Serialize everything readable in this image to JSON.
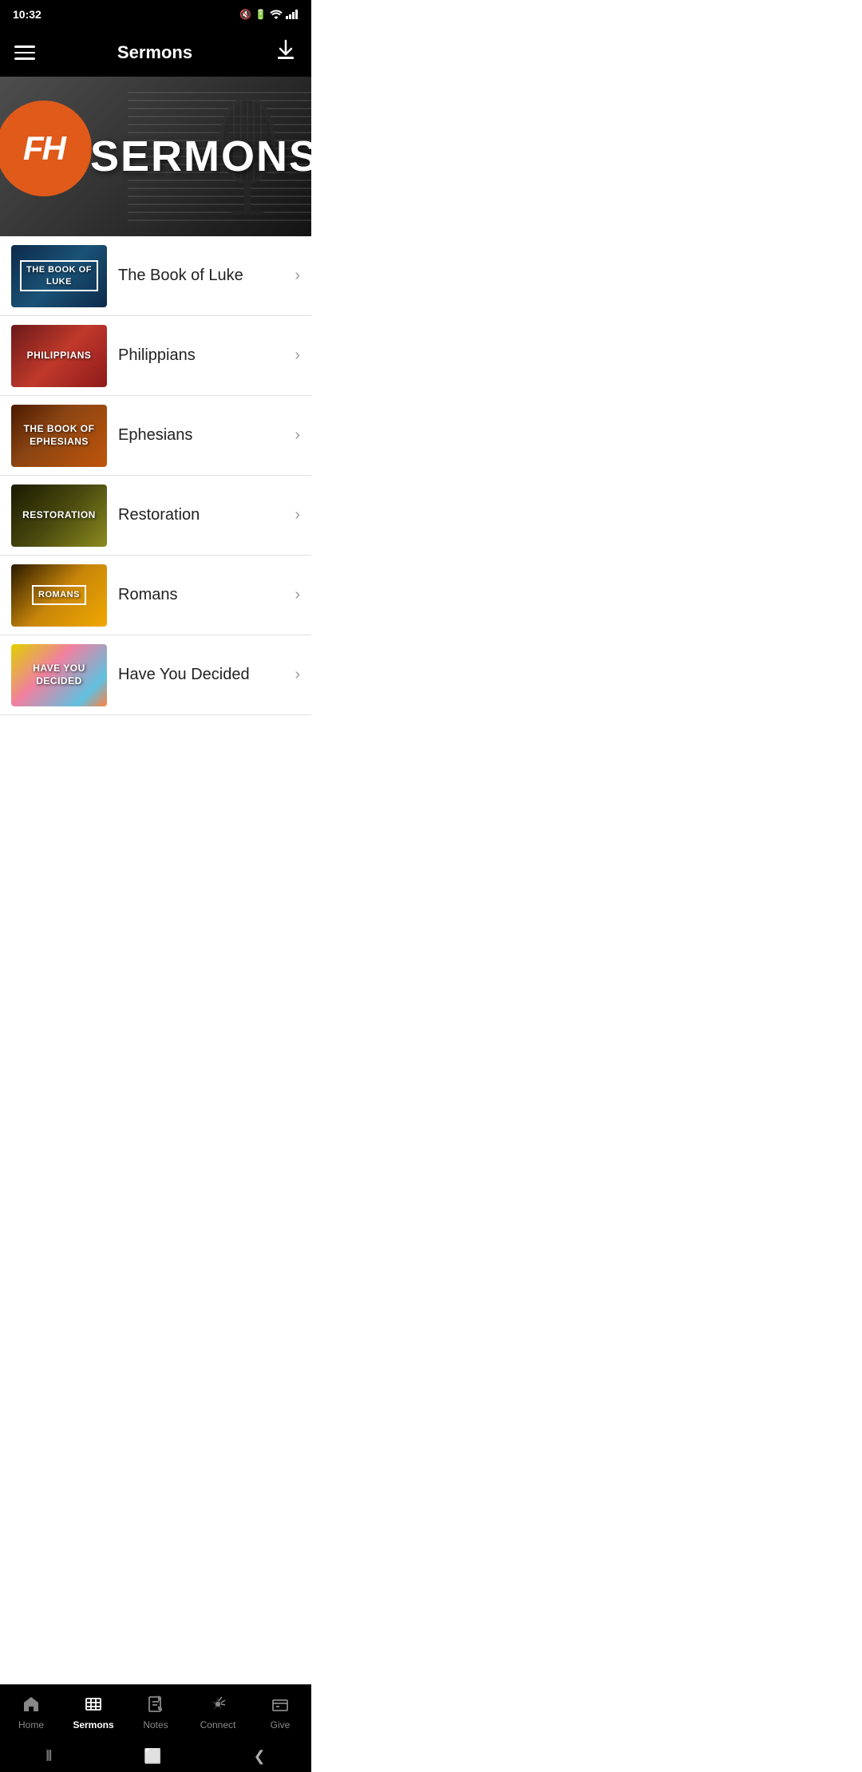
{
  "statusBar": {
    "time": "10:32",
    "icons": [
      "🔇",
      "📶",
      "🔋"
    ]
  },
  "topBar": {
    "title": "Sermons",
    "menuIcon": "menu",
    "downloadIcon": "⬇"
  },
  "banner": {
    "logoLetters": "FH",
    "sermonsBannerText": "SERMONS"
  },
  "sermonList": {
    "items": [
      {
        "id": "luke",
        "title": "The Book of Luke",
        "thumbStyle": "luke",
        "thumbText": "THE BOOK OF\nLUKE",
        "outlined": true
      },
      {
        "id": "philippians",
        "title": "Philippians",
        "thumbStyle": "philippians",
        "thumbText": "PHILIPPIANS",
        "outlined": false
      },
      {
        "id": "ephesians",
        "title": "Ephesians",
        "thumbStyle": "ephesians",
        "thumbText": "THE BOOK OF\nEPHESIANS",
        "outlined": false
      },
      {
        "id": "restoration",
        "title": "Restoration",
        "thumbStyle": "restoration",
        "thumbText": "RESTORATION",
        "outlined": false
      },
      {
        "id": "romans",
        "title": "Romans",
        "thumbStyle": "romans",
        "thumbText": "ROMANS",
        "outlined": true
      },
      {
        "id": "decided",
        "title": "Have You Decided",
        "thumbStyle": "decided",
        "thumbText": "HAVE YOU DECIDED",
        "outlined": false
      }
    ]
  },
  "bottomNav": {
    "items": [
      {
        "id": "home",
        "label": "Home",
        "icon": "📍",
        "active": false
      },
      {
        "id": "sermons",
        "label": "Sermons",
        "icon": "🎞",
        "active": true
      },
      {
        "id": "notes",
        "label": "Notes",
        "icon": "📝",
        "active": false
      },
      {
        "id": "connect",
        "label": "Connect",
        "icon": "📌",
        "active": false
      },
      {
        "id": "give",
        "label": "Give",
        "icon": "💳",
        "active": false
      }
    ]
  },
  "androidNav": {
    "back": "❮",
    "home": "⬜",
    "recent": "⦀"
  }
}
